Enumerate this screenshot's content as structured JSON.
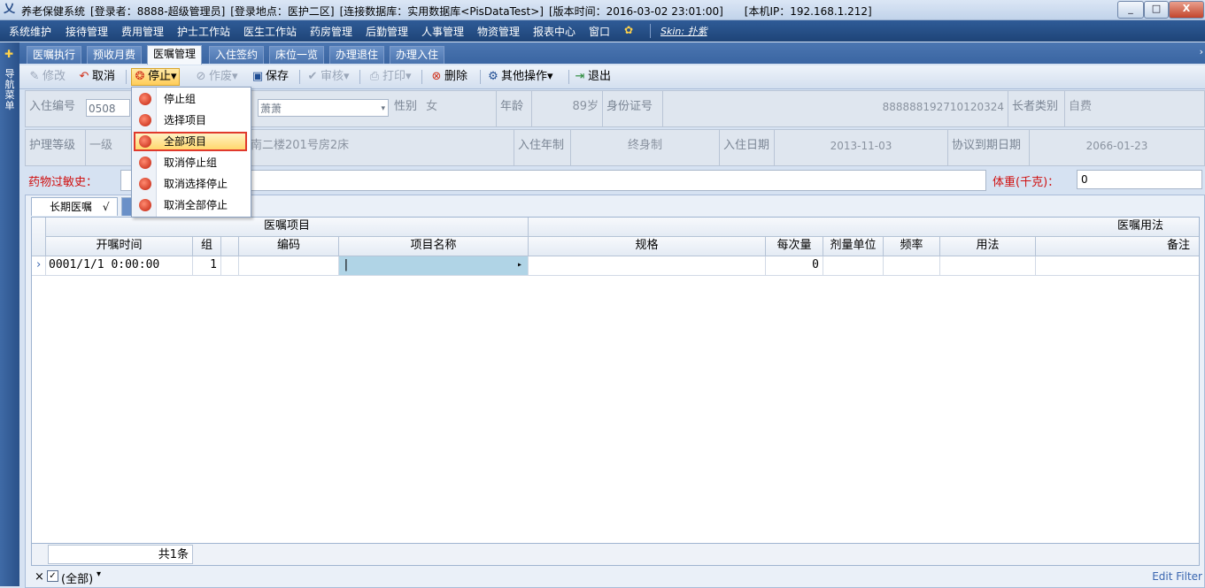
{
  "window": {
    "app_title": "养老保健系统",
    "login_user": "[登录者：8888-超级管理员]",
    "login_place": "[登录地点：医护二区]",
    "database": "[连接数据库：实用数据库<PisDataTest>]",
    "version_time": "[版本时间：2016-03-02 23:01:00]",
    "local_ip": "[本机IP：192.168.1.212]",
    "minimize": "_",
    "maximize": "□",
    "close": "X"
  },
  "menu": {
    "items": [
      "系统维护",
      "接待管理",
      "费用管理",
      "护士工作站",
      "医生工作站",
      "药房管理",
      "后勤管理",
      "人事管理",
      "物资管理",
      "报表中心",
      "窗口"
    ],
    "skin_label": "Skin: 扑紫"
  },
  "left_rail": {
    "label": "导航菜单"
  },
  "tabs": {
    "items": [
      "医嘱执行",
      "预收月费",
      "医嘱管理",
      "入住签约",
      "床位一览",
      "办理退住",
      "办理入住"
    ],
    "active_index": 2,
    "scroll": "›"
  },
  "toolbar": {
    "edit": "修改",
    "cancel": "取消",
    "stop": "停止",
    "void": "作废",
    "save": "保存",
    "audit": "审核",
    "print": "打印",
    "delete": "删除",
    "other": "其他操作",
    "exit": "退出",
    "dropdown_arrow": "▾"
  },
  "stop_menu": {
    "items": [
      "停止组",
      "选择项目",
      "全部项目",
      "取消停止组",
      "取消选择停止",
      "取消全部停止"
    ],
    "highlighted_index": 2
  },
  "form": {
    "row1": {
      "admit_no_label": "入住编号",
      "admit_no_value": "0508",
      "name_value": "萧萧",
      "gender_label": "性别",
      "gender_value": "女",
      "age_label": "年龄",
      "age_value": "89岁",
      "id_label": "身份证号",
      "id_value": "888888192710120324",
      "elder_type_label": "长者类别",
      "elder_type_value": "自费"
    },
    "row2": {
      "care_level_label": "护理等级",
      "care_level_value": "一级",
      "bed_value": "南二楼201号房2床",
      "term_label": "入住年制",
      "term_value": "终身制",
      "admit_date_label": "入住日期",
      "admit_date_value": "2013-11-03",
      "expire_label": "协议到期日期",
      "expire_value": "2066-01-23"
    },
    "allergy_label": "药物过敏史：",
    "weight_label": "体重(千克)：",
    "weight_value": "0"
  },
  "panel": {
    "subtab": "长期医嘱",
    "subtab_check": "√",
    "group_headers": {
      "item": "医嘱项目",
      "usage": "医嘱用法"
    },
    "columns": [
      "开嘱时间",
      "组",
      "编码",
      "项目名称",
      "规格",
      "每次量",
      "剂量单位",
      "频率",
      "用法",
      "备注"
    ],
    "rows": [
      {
        "indicator": "›",
        "time": "0001/1/1 0:00:00",
        "group": "1",
        "code": "",
        "name": "|",
        "spec": "",
        "dose": "0",
        "unit": "",
        "freq": "",
        "usage": "",
        "note": ""
      }
    ],
    "name_cell_arrow": "▸",
    "footer_count": "共1条",
    "filter_close": "×",
    "filter_text": "(全部)",
    "filter_arrow": "▾",
    "edit_filter": "Edit Filter"
  }
}
